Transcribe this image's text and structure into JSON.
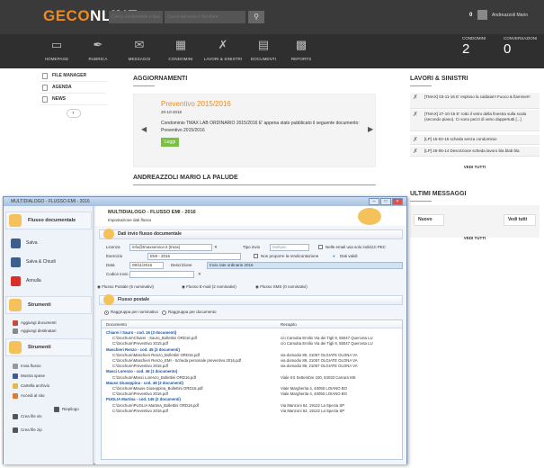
{
  "header": {
    "logo_a": "GECO",
    "logo_b": "NLINE",
    "search1_placeholder": "Cerca condominio o fascicolo",
    "search2_placeholder": "Cerca persona o fornitore",
    "notifications": "0",
    "username": "Andreazzoli Mario"
  },
  "nav": {
    "items": [
      {
        "label": "HOMEPAGE",
        "icon": "monitor-icon"
      },
      {
        "label": "RUBRICA",
        "icon": "pen-icon"
      },
      {
        "label": "MESSAGGI",
        "icon": "envelope-icon"
      },
      {
        "label": "CONDOMINI",
        "icon": "building-icon"
      },
      {
        "label": "LAVORI & SINISTRI",
        "icon": "tools-icon"
      },
      {
        "label": "DOCUMENTI",
        "icon": "document-icon"
      },
      {
        "label": "REPORTS",
        "icon": "chart-icon"
      }
    ],
    "stats": [
      {
        "label": "CONDOMINI",
        "value": "2"
      },
      {
        "label": "CONVERSAZIONI",
        "value": "0"
      }
    ]
  },
  "sidemenu": {
    "items": [
      "FILE MANAGER",
      "AGENDA",
      "NEWS"
    ]
  },
  "updates": {
    "title": "AGGIORNAMENTI",
    "item_title": "Preventivo 2015/2016",
    "item_date": "20-10-2016",
    "item_text": "Condominio TMAX LAB ORDINARIO 2015/2016 E' appena stato pubblicato il seguente documento: Preventivo 2015/2016",
    "button": "Leggi"
  },
  "section2_title": "ANDREAZZOLI MARIO LA PALUDE",
  "lavori": {
    "title": "LAVORI & SINISTRI",
    "items": [
      "[TMAX] 03-11-16 E' esploso la caldaia!!! Fuoco & fiamme!!!",
      "[TMAX] 27-10-16 E' rotto il vetro della finestra sulla scala (secondo piano). Ci sono pezzi di vetro dappertutti [...]",
      "[LP] 15-02-15 scheda senza condominio",
      "[LP] 26-06-14 Descrizione scheda lavoro bla blab bla"
    ],
    "vedi": "VEDI TUTTI"
  },
  "messages": {
    "title": "ULTIMI MESSAGGI",
    "new_btn": "Nuovo",
    "all_btn": "Vedi tutti",
    "vedi": "VEDI TUTTI"
  },
  "dialog": {
    "window_title": "MULTIDIALOGO - FLUSSO EMI - 2016",
    "side": {
      "head1": "Flusso documentale",
      "btn_salva": "Salva",
      "btn_salva_chiudi": "Salva & Chiudi",
      "btn_annulla": "Annulla",
      "head2": "Strumenti",
      "sm1": "Aggiungi documenti",
      "sm2": "Aggiungi destinatari",
      "head3": "Strumenti",
      "sm3": "Invia flusso",
      "sm4": "Mostra spese",
      "sm5": "Cartella archivio",
      "sm6": "Accedi al sito",
      "btn_crea_xls": "Crea file xls",
      "btn_riepilogo": "Riepilogo",
      "btn_crea_zip": "Crea file zip"
    },
    "head_title": "MULTIDIALOGO - FLUSSO EMI - 2016",
    "head_sub": "Impostazione dati flusso",
    "panel1": "Dati invio flusso documentale",
    "f_licenza_lbl": "Licenza",
    "f_licenza": "info@tmaxservice.it (tmax)",
    "f_tipo_lbl": "Tipo invio",
    "f_tipo": "Multiplo",
    "f_pec": "Nelle email usa solo indirizzi PEC",
    "f_esercizio_lbl": "Esercizio",
    "f_esercizio": "EMI - 2016",
    "f_norend": "Non proporre la rendicontazione",
    "f_dati": "Dati validi",
    "f_data_lbl": "Data",
    "f_data": "08/11/2016",
    "f_desc_lbl": "Descrizione",
    "f_desc": "Invio rate ordinarie 2016",
    "f_codice_lbl": "Codice invio",
    "tabs": [
      "Flusso Postale (5 nominativi)",
      "Flusso E-mail (2 nominativi)",
      "Flusso SMS (0 nominativi)"
    ],
    "panel2": "Flusso postale",
    "radio1": "Raggruppa per nominativo",
    "radio2": "Raggruppa per documento",
    "col_doc": "Documento",
    "col_rec": "Recapito",
    "rows": [
      {
        "t": "grp",
        "a": "Chiarei / Sauro - cod. 16 (2 documenti)",
        "b": ""
      },
      {
        "t": "doc",
        "a": "C:\\brochure\\Chiarei - Sauro_Bollettini ORD16.pdf",
        "b": "c/o Camuba Emilio Via dei Tigli 9, 55047 Querceta LU"
      },
      {
        "t": "doc",
        "a": "C:\\brochure\\Preventivo 2015.pdf",
        "b": "c/o Camuba Emilio Via dei Tigli 9, 55047 Querceta LU"
      },
      {
        "t": "grp",
        "a": "Maschieri Renzo - cod. 45 (3 documenti)",
        "b": ""
      },
      {
        "t": "doc",
        "a": "C:\\brochure\\Maschieri Renzo_Bollettini ORD16.pdf",
        "b": "via domodio 89, 21057 OLGIATE OLONA VA"
      },
      {
        "t": "doc",
        "a": "C:\\brochure\\Maschieri Renzo_EMI - Scheda personale preventivo 2016.pdf",
        "b": "via domodio 89, 21057 OLGIATE OLONA VA"
      },
      {
        "t": "doc",
        "a": "C:\\brochure\\Preventivo 2016.pdf",
        "b": "via domodio 89, 21057 OLGIATE OLONA VA"
      },
      {
        "t": "grp",
        "a": "Masci Lorenzo - cod. 46 (1 documento)",
        "b": ""
      },
      {
        "t": "doc",
        "a": "C:\\brochure\\Masci Lorenzo_Bollettini ORD16.pdf",
        "b": "Viale XX Settembre 100, 54033 Carrara MS"
      },
      {
        "t": "grp",
        "a": "Mauss Giuseppina - cod. 48 (2 documenti)",
        "b": ""
      },
      {
        "t": "doc",
        "a": "C:\\brochure\\Mauss Giuseppina_Bollettini ORD16.pdf",
        "b": "Viale Margherita 4, 40050 LOIANO BO"
      },
      {
        "t": "doc",
        "a": "C:\\brochure\\Preventivo 2016.pdf",
        "b": "Viale Margherita 4, 40050 LOIANO BO"
      },
      {
        "t": "grp",
        "a": "PUGLIA Martina - cod. 145 (2 documenti)",
        "b": ""
      },
      {
        "t": "doc",
        "a": "C:\\brochure\\PUGLIA Martina_Bollettini ORD16.pdf",
        "b": "Via Manzoni 64, 19122 La Spezia SP"
      },
      {
        "t": "doc",
        "a": "C:\\brochure\\Preventivo 2016.pdf",
        "b": "Via Manzoni 64, 19122 La Spezia SP"
      }
    ]
  }
}
